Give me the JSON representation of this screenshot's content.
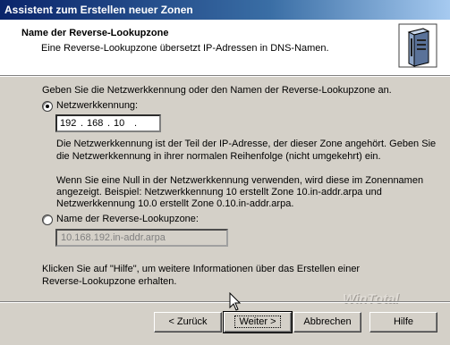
{
  "window": {
    "title": "Assistent zum Erstellen neuer Zonen"
  },
  "header": {
    "title": "Name der Reverse-Lookupzone",
    "subtitle": "Eine Reverse-Lookupzone übersetzt IP-Adressen in DNS-Namen.",
    "icon": "server-icon"
  },
  "main": {
    "intro": "Geben Sie die Netzwerkkennung oder den Namen der Reverse-Lookupzone an.",
    "option_network_id": {
      "label": "Netzwerkkennung:",
      "selected": true,
      "octets": [
        "192",
        "168",
        "10",
        ""
      ],
      "help1_line1": "Die Netzwerkkennung ist der Teil der IP-Adresse, der dieser Zone angehört. Geben Sie",
      "help1_line2": "die Netzwerkkennung in ihrer normalen Reihenfolge (nicht umgekehrt) ein.",
      "help2_line1": "Wenn Sie eine Null in der Netzwerkkennung verwenden, wird diese im Zonennamen",
      "help2_line2": "angezeigt. Beispiel: Netzwerkkennung 10 erstellt Zone 10.in-addr.arpa und",
      "help2_line3": "Netzwerkkennung 10.0 erstellt Zone 0.10.in-addr.arpa."
    },
    "option_zone_name": {
      "label": "Name der Reverse-Lookupzone:",
      "selected": false,
      "value": "10.168.192.in-addr.arpa"
    },
    "footer_line1": "Klicken Sie auf \"Hilfe\", um weitere Informationen über das Erstellen einer",
    "footer_line2": "Reverse-Lookupzone erhalten."
  },
  "buttons": {
    "back": "< Zurück",
    "next": "Weiter >",
    "cancel": "Abbrechen",
    "help": "Hilfe"
  },
  "watermark": "WinTotal"
}
